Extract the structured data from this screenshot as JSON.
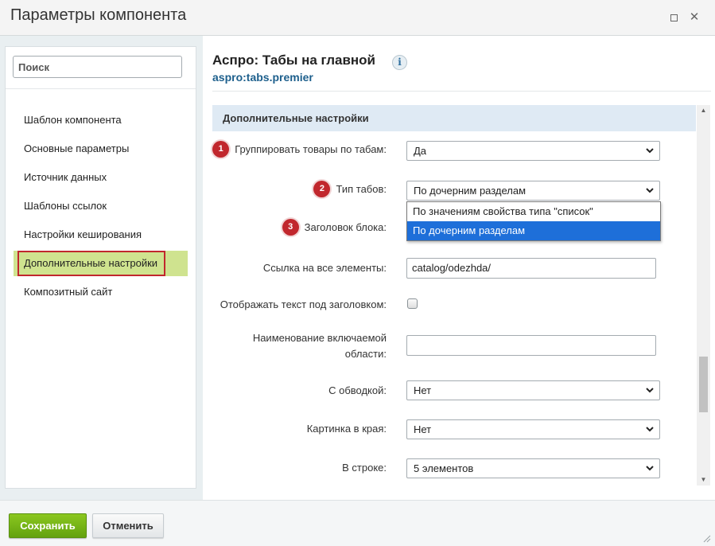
{
  "window": {
    "title": "Параметры компонента"
  },
  "sidebar": {
    "search_placeholder": "Поиск",
    "items": [
      {
        "label": "Шаблон компонента"
      },
      {
        "label": "Основные параметры"
      },
      {
        "label": "Источник данных"
      },
      {
        "label": "Шаблоны ссылок"
      },
      {
        "label": "Настройки кеширования"
      },
      {
        "label": "Дополнительные настройки",
        "active": true
      },
      {
        "label": "Композитный сайт"
      }
    ]
  },
  "component": {
    "title": "Аспро: Табы на главной",
    "code": "aspro:tabs.premier",
    "info_icon": "i"
  },
  "section": {
    "title": "Дополнительные настройки"
  },
  "fields": {
    "group_by_tabs": {
      "badge": "1",
      "label": "Группировать товары по табам:",
      "value": "Да"
    },
    "tab_type": {
      "badge": "2",
      "label": "Тип табов:",
      "value": "По дочерним разделам"
    },
    "block_title": {
      "badge": "3",
      "label": "Заголовок блока:"
    },
    "all_link": {
      "label": "Ссылка на все элементы:",
      "value": "catalog/odezhda/"
    },
    "show_text": {
      "label": "Отображать текст под заголовком:"
    },
    "include_area": {
      "label": "Наименование включаемой области:",
      "value": ""
    },
    "bordered": {
      "label": "С обводкой:",
      "value": "Нет"
    },
    "edge_image": {
      "label": "Картинка в края:",
      "value": "Нет"
    },
    "per_row": {
      "label": "В строке:",
      "value": "5 элементов"
    }
  },
  "dropdown": {
    "options": [
      {
        "label": "По значениям свойства типа \"список\""
      },
      {
        "label": "По дочерним разделам",
        "selected": true
      }
    ]
  },
  "footer": {
    "save_label": "Сохранить",
    "cancel_label": "Отменить"
  },
  "colors": {
    "accent_green": "#6fae14",
    "badge_red": "#c1272d",
    "active_item_bg": "#cfe38f",
    "section_header_bg": "#dfeaf4",
    "selected_option_bg": "#1e6fd9"
  }
}
